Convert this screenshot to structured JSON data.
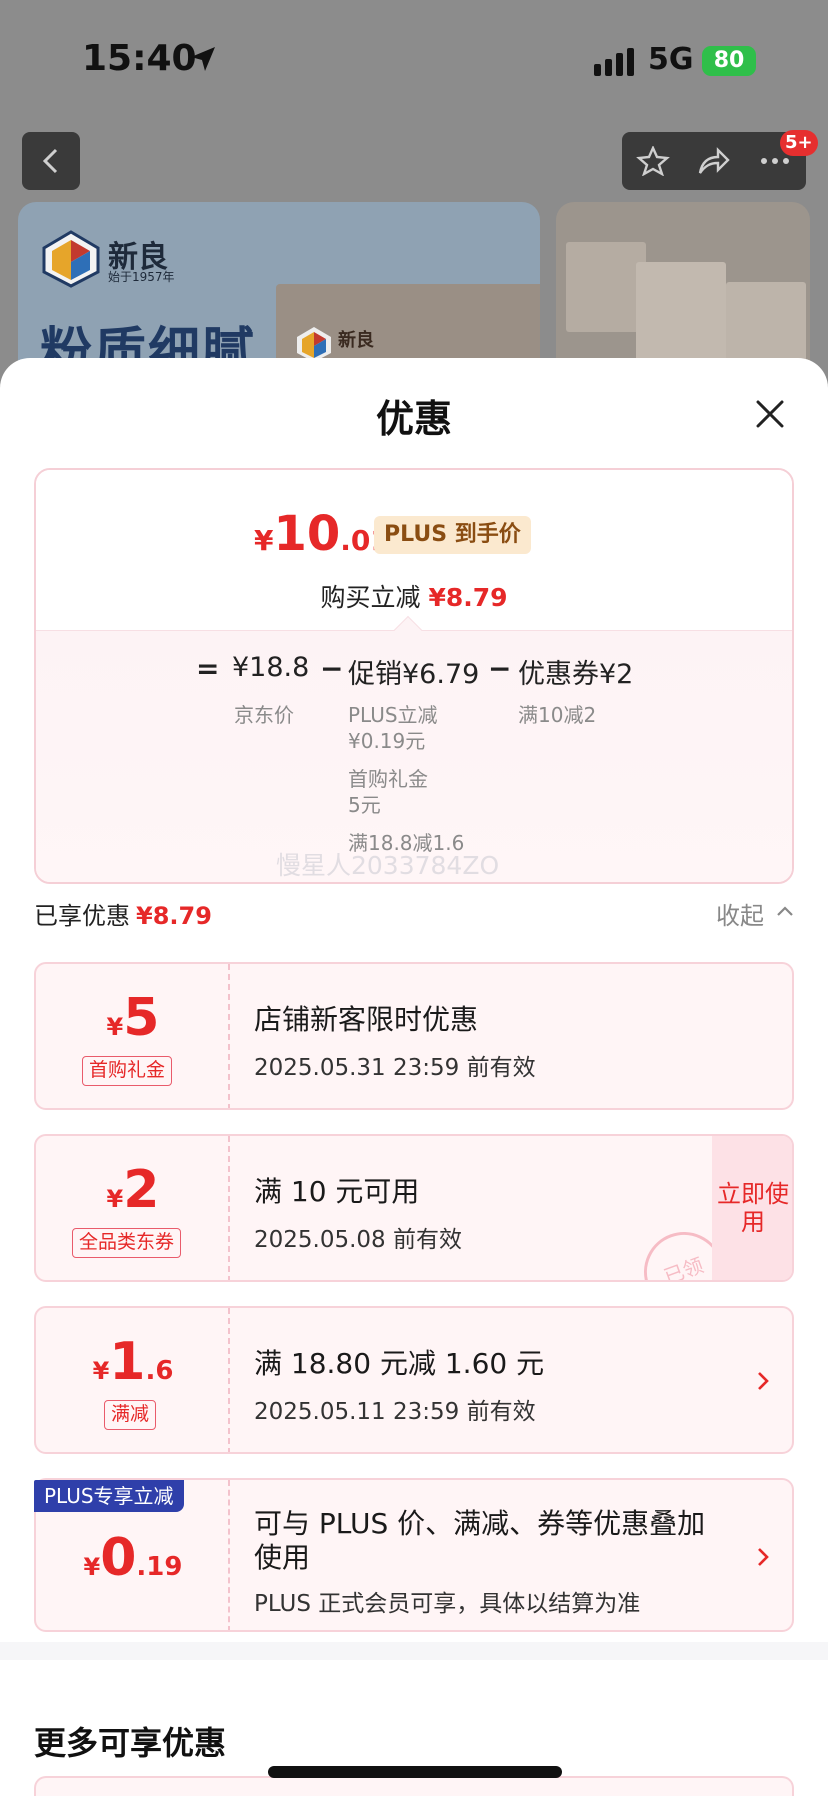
{
  "status_bar": {
    "time": "15:40",
    "network": "5G",
    "battery": "80"
  },
  "nav": {
    "badge": "5+"
  },
  "banner": {
    "brand_name": "新良",
    "brand_sub": "始于1957年",
    "slogan": "粉质细腻",
    "box_brand": "新良"
  },
  "sheet": {
    "title": "优惠",
    "final_price": {
      "currency": "¥",
      "integer": "10",
      "decimal": ".01"
    },
    "plus_tag": "PLUS 到手价",
    "reduce_label": "购买立减",
    "reduce_amount": "¥8.79",
    "formula": {
      "eq": "=",
      "jd_price": "¥18.8",
      "minus1": "−",
      "promo": "促销¥6.79",
      "minus2": "−",
      "coupon": "优惠券¥2",
      "jd_label": "京东价",
      "promo_details": [
        "PLUS立减",
        "¥0.19元",
        "首购礼金",
        "5元",
        "满18.8减1.6"
      ],
      "coupon_detail": "满10减2"
    },
    "watermark": "慢星人2033784ZO",
    "enjoyed_label": "已享优惠",
    "enjoyed_amount": "¥8.79",
    "collapse_label": "收起"
  },
  "coupons": [
    {
      "currency": "¥",
      "integer": "5",
      "decimal": "",
      "tag": "首购礼金",
      "title": "店铺新客限时优惠",
      "subtitle": "2025.05.31 23:59 前有效"
    },
    {
      "currency": "¥",
      "integer": "2",
      "decimal": "",
      "tag": "全品类东券",
      "title": "满 10 元可用",
      "subtitle": "2025.05.08 前有效",
      "action": "立即使用",
      "stamp": "已领"
    },
    {
      "currency": "¥",
      "integer": "1",
      "decimal": ".6",
      "tag": "满减",
      "title": "满 18.80 元减 1.60 元",
      "subtitle": "2025.05.11 23:59 前有效"
    },
    {
      "badge": "PLUS专享立减",
      "currency": "¥",
      "integer": "0",
      "decimal": ".19",
      "title_line1": "可与 PLUS 价、满减、券等优惠叠加",
      "title_line2": "使用",
      "subtitle": "PLUS 正式会员可享，具体以结算为准"
    }
  ],
  "more_section": {
    "title": "更多可享优惠"
  },
  "colors": {
    "accent_red": "#e62828",
    "plus_blue": "#2f3faa",
    "plus_gold": "#8a4d12"
  }
}
